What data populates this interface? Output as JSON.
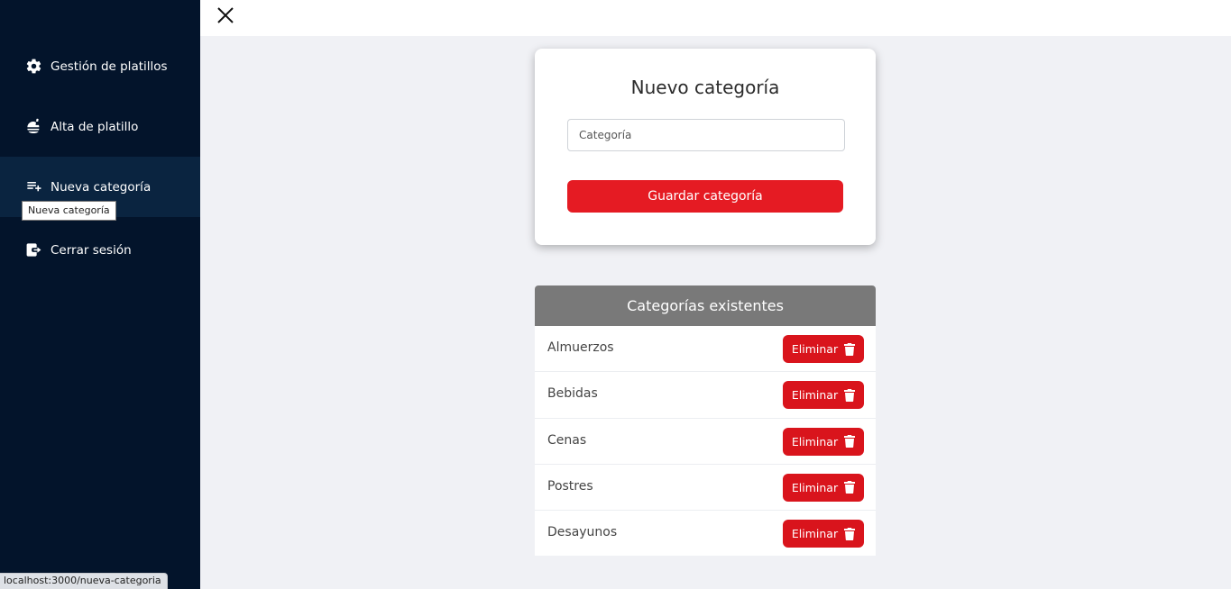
{
  "sidebar": {
    "items": [
      {
        "label": "Gestión de platillos",
        "icon": "gear-icon"
      },
      {
        "label": "Alta de platillo",
        "icon": "food-icon"
      },
      {
        "label": "Nueva categoría",
        "icon": "playlist-add-icon",
        "active": true
      },
      {
        "label": "Cerrar sesión",
        "icon": "logout-icon"
      }
    ],
    "tooltip": "Nueva categoría"
  },
  "status_bar": {
    "url": "localhost:3000/nueva-categoria"
  },
  "topbar": {
    "close_icon": "close-icon"
  },
  "form": {
    "title": "Nuevo categoría",
    "input_placeholder": "Categoría",
    "input_value": "",
    "save_label": "Guardar categoría"
  },
  "categories": {
    "header": "Categorías existentes",
    "delete_label": "Eliminar",
    "items": [
      "Almuerzos",
      "Bebidas",
      "Cenas",
      "Postres",
      "Desayunos"
    ]
  },
  "colors": {
    "sidebar_bg": "#03142b",
    "accent_red": "#e51b23",
    "list_header_bg": "#797979",
    "page_bg": "#f0f1f5"
  }
}
